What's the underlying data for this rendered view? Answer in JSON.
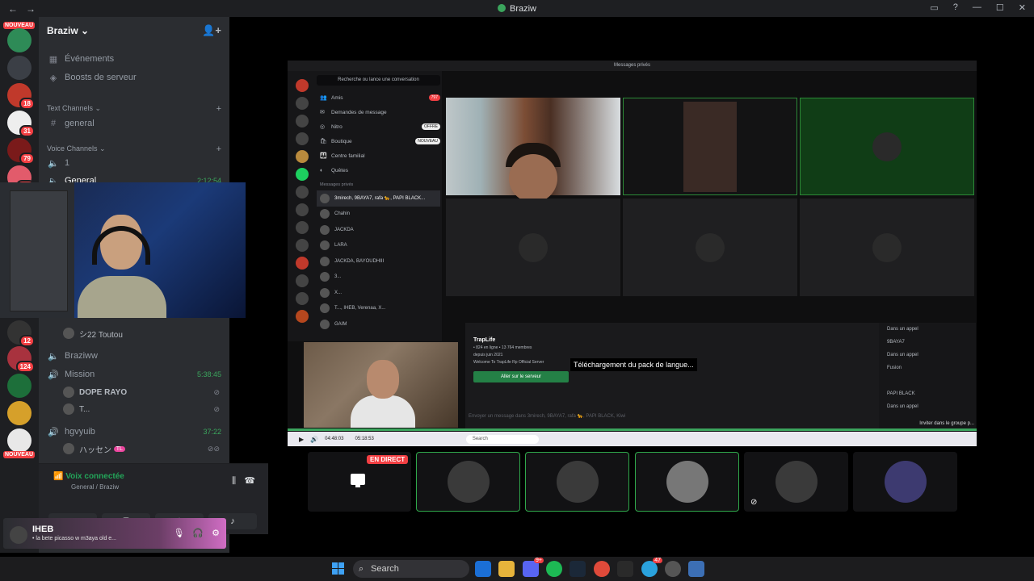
{
  "window": {
    "title": "Braziw"
  },
  "server": {
    "name": "Braziw",
    "events": "Événements",
    "boosts": "Boosts de serveur",
    "text_category": "Text Channels",
    "text_channel": "general",
    "voice_category": "Voice Channels",
    "voice_channel_1": "1",
    "voice_channel_general": "General",
    "voice_channel_general_time": "2:12:54",
    "toutou": "シ22 Toutou",
    "braziww": "Braziww",
    "mission": "Mission",
    "mission_time": "5:38:45",
    "dope": "DOPE RAYO",
    "t_user": "T...",
    "hgvyuib": "hgvyuib",
    "hgvyuib_time": "37:22",
    "hassen": "ハッセン",
    "hassen_tag": "TL"
  },
  "guild_badges": [
    "NOUVEAU",
    "18",
    "31",
    "79",
    "101",
    "12",
    "124",
    "NOUVEAU"
  ],
  "voice_panel": {
    "status": "Voix connectée",
    "channel": "General / Braziw"
  },
  "user_panel": {
    "name": "IHEB",
    "status": "• la bete picasso w m3aya old e..."
  },
  "inner_app": {
    "title": "Messages privés",
    "search": "Recherche ou lance une conversation",
    "menu": [
      {
        "label": "Amis",
        "tag": "797"
      },
      {
        "label": "Demandes de message",
        "tag": ""
      },
      {
        "label": "Nitro",
        "tag": "OFFRE"
      },
      {
        "label": "Boutique",
        "tag": "NOUVEAU"
      },
      {
        "label": "Centre familial",
        "tag": ""
      },
      {
        "label": "Quêtes",
        "tag": ""
      }
    ],
    "dm_header": "Messages privés",
    "dms": [
      "3mirech, 9BAYA7, rafa 🐆, PAPI BLACK...",
      "Chahin",
      "JACKDA",
      "LARA",
      "JACKDA, BAYOUDHIII",
      "3...",
      "X...",
      "T..., IHEB, Verenaa, X...",
      "GAIM"
    ],
    "server_card": {
      "name": "TrapLife",
      "stats": "• 824 en ligne • 13 764 membres",
      "since": "depuis juin 2021",
      "welcome": "Welcome To TrapLife Rp Official Server",
      "button": "Aller sur le serveur"
    },
    "chat_placeholder": "Envoyer un message dans 3mirech, 9BAYA7, rafa 🐆, PAPI BLACK, Kiwi",
    "members": [
      "Dans un appel",
      "9BAYA7",
      "Dans un appel",
      "Fusion",
      "",
      "",
      "PAPI BLACK",
      "Dans un appel"
    ],
    "invite": "Inviter dans le groupe p..."
  },
  "tooltip": "Téléchargement du pack de langue...",
  "player": {
    "elapsed": "04:48:03",
    "total": "05:18:53",
    "search": "Search"
  },
  "stream": {
    "live_badge": "EN DIRECT"
  },
  "taskbar": {
    "search": "Search",
    "discord_badge": "9+",
    "telegram_badge": "47"
  },
  "colors": {
    "accent_green": "#23a559",
    "danger_red": "#f23f43",
    "sidebar": "#2b2d31",
    "guild_bar": "#1e1f22"
  }
}
